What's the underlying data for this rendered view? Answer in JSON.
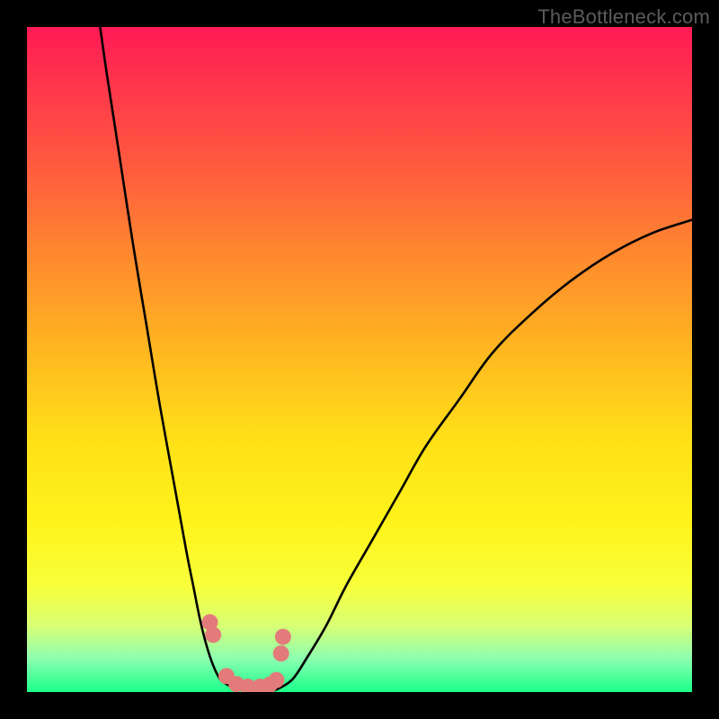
{
  "watermark": "TheBottleneck.com",
  "chart_data": {
    "type": "line",
    "title": "",
    "xlabel": "",
    "ylabel": "",
    "xlim": [
      0,
      100
    ],
    "ylim": [
      0,
      100
    ],
    "grid": false,
    "legend": false,
    "background_gradient": [
      "#ff1a55",
      "#ff5e3e",
      "#ffb521",
      "#fff21a",
      "#1aff89"
    ],
    "series": [
      {
        "name": "curve-1",
        "stroke": "#000000",
        "x": [
          11,
          12,
          14,
          16,
          18,
          20,
          22,
          24,
          25,
          26,
          27,
          28,
          29,
          30,
          31,
          32,
          33
        ],
        "y": [
          100,
          93,
          80,
          67,
          55,
          43,
          32,
          21,
          16,
          11,
          7,
          4,
          2,
          1.2,
          0.7,
          0.4,
          0.2
        ]
      },
      {
        "name": "curve-2",
        "stroke": "#000000",
        "x": [
          37,
          38,
          40,
          42,
          45,
          48,
          52,
          56,
          60,
          65,
          70,
          76,
          82,
          88,
          94,
          100
        ],
        "y": [
          0.2,
          0.6,
          2,
          5,
          10,
          16,
          23,
          30,
          37,
          44,
          51,
          57,
          62,
          66,
          69,
          71
        ]
      }
    ],
    "markers": {
      "name": "highlighted-points",
      "color": "#e37b7a",
      "radius_px": 9,
      "points": [
        {
          "x": 27.5,
          "y": 10.5
        },
        {
          "x": 28.0,
          "y": 8.6
        },
        {
          "x": 30.0,
          "y": 2.4
        },
        {
          "x": 31.5,
          "y": 1.2
        },
        {
          "x": 33.2,
          "y": 0.8
        },
        {
          "x": 35.0,
          "y": 0.8
        },
        {
          "x": 36.5,
          "y": 1.1
        },
        {
          "x": 37.5,
          "y": 1.8
        },
        {
          "x": 38.2,
          "y": 5.8
        },
        {
          "x": 38.5,
          "y": 8.3
        }
      ]
    }
  }
}
